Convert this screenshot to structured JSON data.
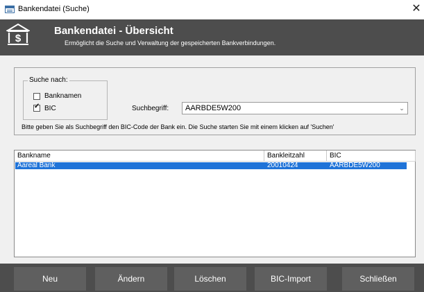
{
  "window": {
    "title": "Bankendatei  (Suche)",
    "close_glyph": "✕"
  },
  "header": {
    "title": "Bankendatei - Übersicht",
    "subtitle": "Ermöglicht die Suche und Verwaltung der gespeicherten Bankverbindungen.",
    "icon": "bank-dollar-icon",
    "background": "#4d4d4d"
  },
  "search": {
    "group_label": "Suche nach:",
    "options": [
      {
        "label": "Banknamen",
        "checked": false
      },
      {
        "label": "BIC",
        "checked": true
      }
    ],
    "term_label": "Suchbegriff:",
    "term_value": "AARBDE5W200",
    "hint": "Bitte geben Sie als Suchbegriff den BIC-Code der Bank ein. Die Suche starten Sie mit einem klicken auf 'Suchen'"
  },
  "results": {
    "columns": [
      "Bankname",
      "Bankleitzahl",
      "BIC"
    ],
    "rows": [
      {
        "name": "Aareal Bank",
        "blz": "20010424",
        "bic": "AARBDE5W200",
        "selected": true
      }
    ],
    "selection_color": "#1f73d8"
  },
  "buttons": [
    "Neu",
    "Ändern",
    "Löschen",
    "BIC-Import",
    "Schließen"
  ]
}
